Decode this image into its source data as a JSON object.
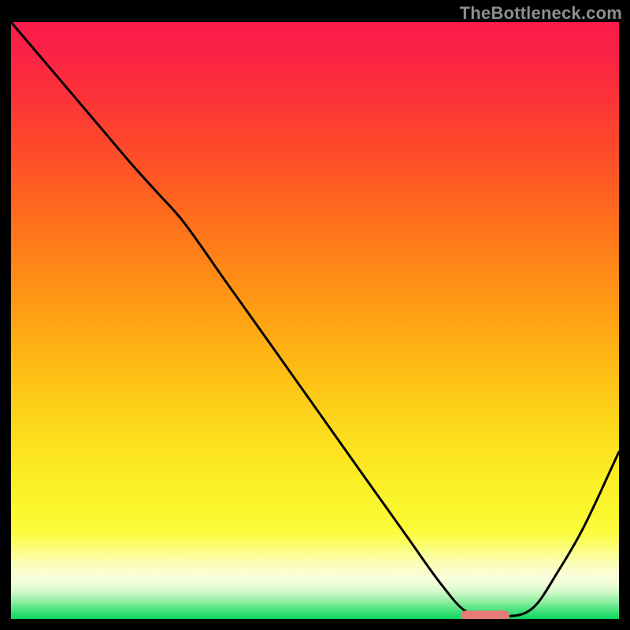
{
  "watermark": "TheBottleneck.com",
  "colors": {
    "curve": "#000000",
    "marker": "#e77a78",
    "frame_bg": "#000000"
  },
  "chart_data": {
    "type": "line",
    "title": "",
    "xlabel": "",
    "ylabel": "",
    "xlim": [
      0,
      100
    ],
    "ylim": [
      0,
      100
    ],
    "grid": false,
    "legend": false,
    "x": [
      0,
      5,
      10,
      15,
      20,
      24,
      28,
      35,
      42,
      50,
      58,
      65,
      71,
      74.5,
      78,
      82,
      86,
      90,
      94,
      100
    ],
    "values": [
      100,
      94,
      88,
      82,
      76,
      71.5,
      67,
      57,
      47,
      35.5,
      24,
      14,
      5.5,
      1.5,
      0.5,
      0.5,
      2,
      8,
      15,
      28
    ],
    "smoothing": "monotone-cubic",
    "marker": {
      "x_start": 74,
      "x_end": 82,
      "y": 0.6,
      "height_pct": 1.6
    }
  }
}
